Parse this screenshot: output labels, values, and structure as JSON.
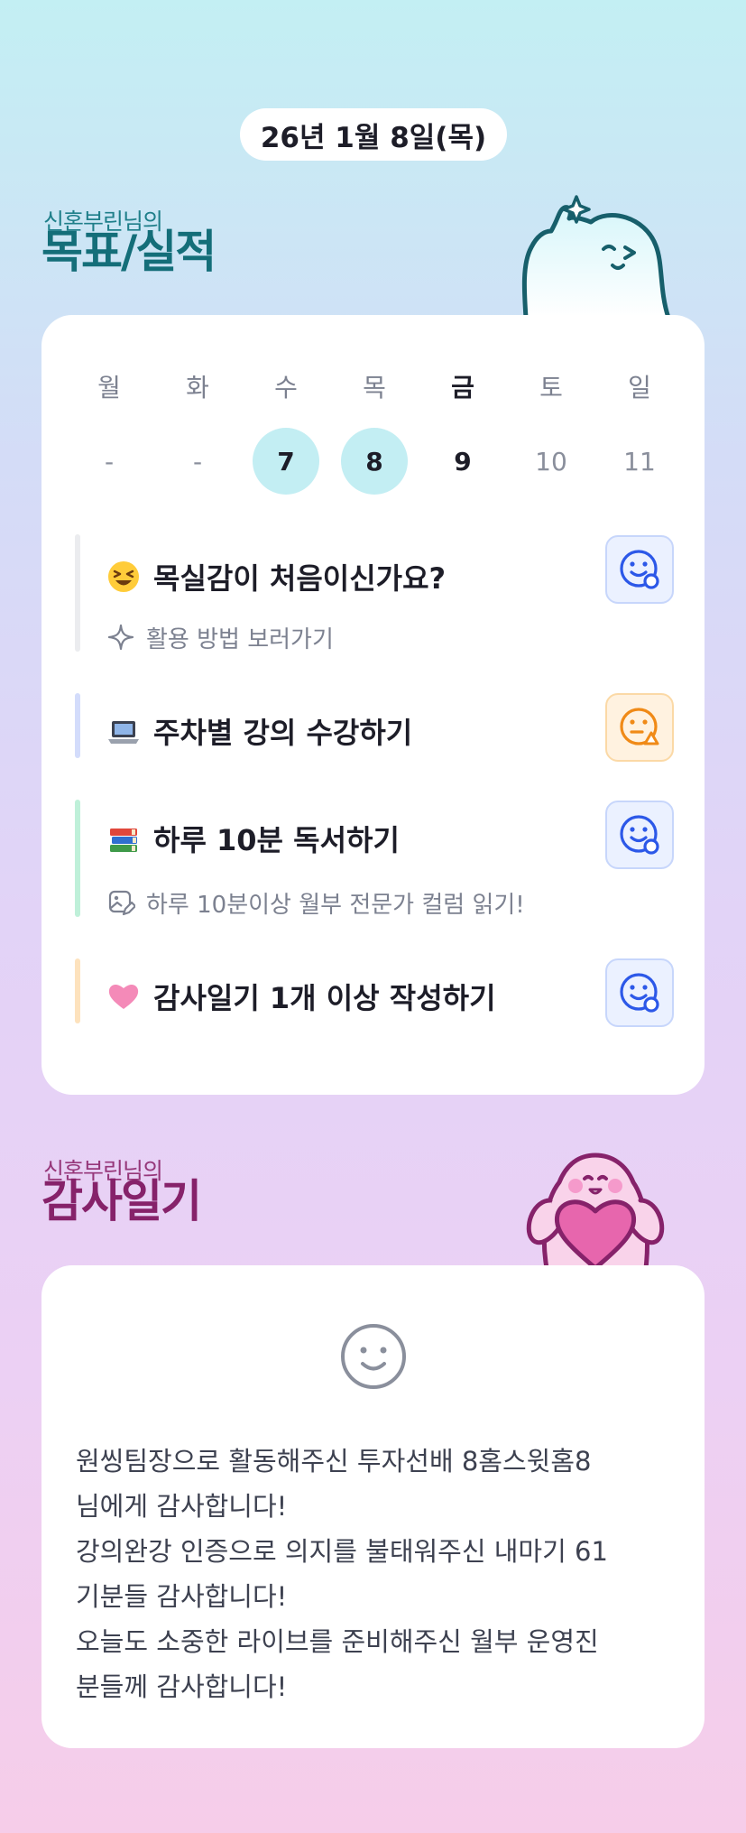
{
  "header": {
    "date": "26년 1월 8일(목)"
  },
  "goals_section": {
    "subtitle": "신혼부린님의",
    "title": "목표/실적",
    "week_labels": [
      "월",
      "화",
      "수",
      "목",
      "금",
      "토",
      "일"
    ],
    "week_days": [
      "-",
      "-",
      "7",
      "8",
      "9",
      "10",
      "11"
    ],
    "items": [
      {
        "emoji": "grinning-squint-face",
        "title": "목실감이 처음이신가요?",
        "sub": "활용 방법 보러가기",
        "status": "blue",
        "bar_color": "#ebecef"
      },
      {
        "emoji": "laptop",
        "title": "주차별 강의 수강하기",
        "sub": "",
        "status": "orange",
        "bar_color": "#d3dcfb"
      },
      {
        "emoji": "books",
        "title": "하루 10분 독서하기",
        "sub": "하루 10분이상 월부 전문가 컬럼 읽기!",
        "status": "blue",
        "bar_color": "#bff0d9"
      },
      {
        "emoji": "pink-heart",
        "title": "감사일기 1개 이상 작성하기",
        "sub": "",
        "status": "blue",
        "bar_color": "#fde2bd"
      }
    ]
  },
  "thanks_section": {
    "subtitle": "신혼부린님의",
    "title": "감사일기",
    "lines": [
      "원씽팀장으로 활동해주신 투자선배 8홈스윗홈8",
      "님에게 감사합니다!",
      "강의완강 인증으로 의지를 불태워주신 내마기 61",
      "기분들 감사합니다!",
      "오늘도 소중한 라이브를 준비해주신 월부 운영진",
      "분들께 감사합니다!"
    ]
  },
  "colors": {
    "teal_title": "#146e79",
    "pink_title": "#86226a",
    "done_day_bg": "#c3eef3",
    "face_blue": "#2c58e8",
    "face_orange": "#f08a17"
  }
}
